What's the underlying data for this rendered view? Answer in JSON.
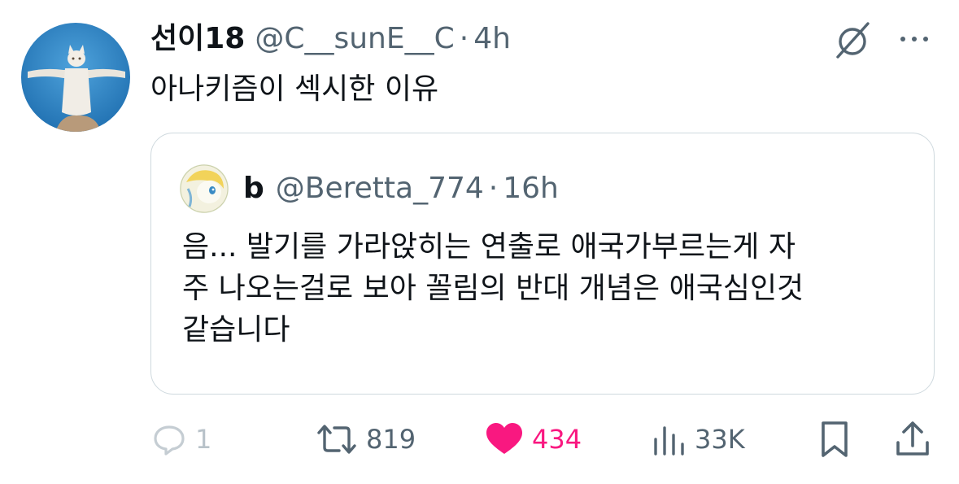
{
  "tweet": {
    "display_name": "선이18",
    "handle": "@C__sunE__C",
    "separator": "·",
    "time": "4h",
    "text": "아나키즘이 섹시한 이유"
  },
  "quoted_tweet": {
    "display_name": "b",
    "handle": "@Beretta_774",
    "separator": "·",
    "time": "16h",
    "text_lines": [
      "음... 발기를 가라앉히는 연출로 애국가부르는게 자",
      "주 나오는걸로 보아 꼴림의 반대 개념은 애국심인것",
      "같습니다"
    ]
  },
  "actions": {
    "replies": "1",
    "reposts": "819",
    "likes": "434",
    "views": "33K"
  },
  "icons": {
    "grok": "grok-icon",
    "more": "more-icon",
    "reply": "reply-icon",
    "retweet": "retweet-icon",
    "like": "heart-icon",
    "views": "views-icon",
    "bookmark": "bookmark-icon",
    "share": "share-icon"
  },
  "colors": {
    "text_primary": "#0f1419",
    "text_secondary": "#536471",
    "like_active": "#f91880",
    "border": "#cfd9de",
    "avatar_background": "#2e88c9"
  }
}
